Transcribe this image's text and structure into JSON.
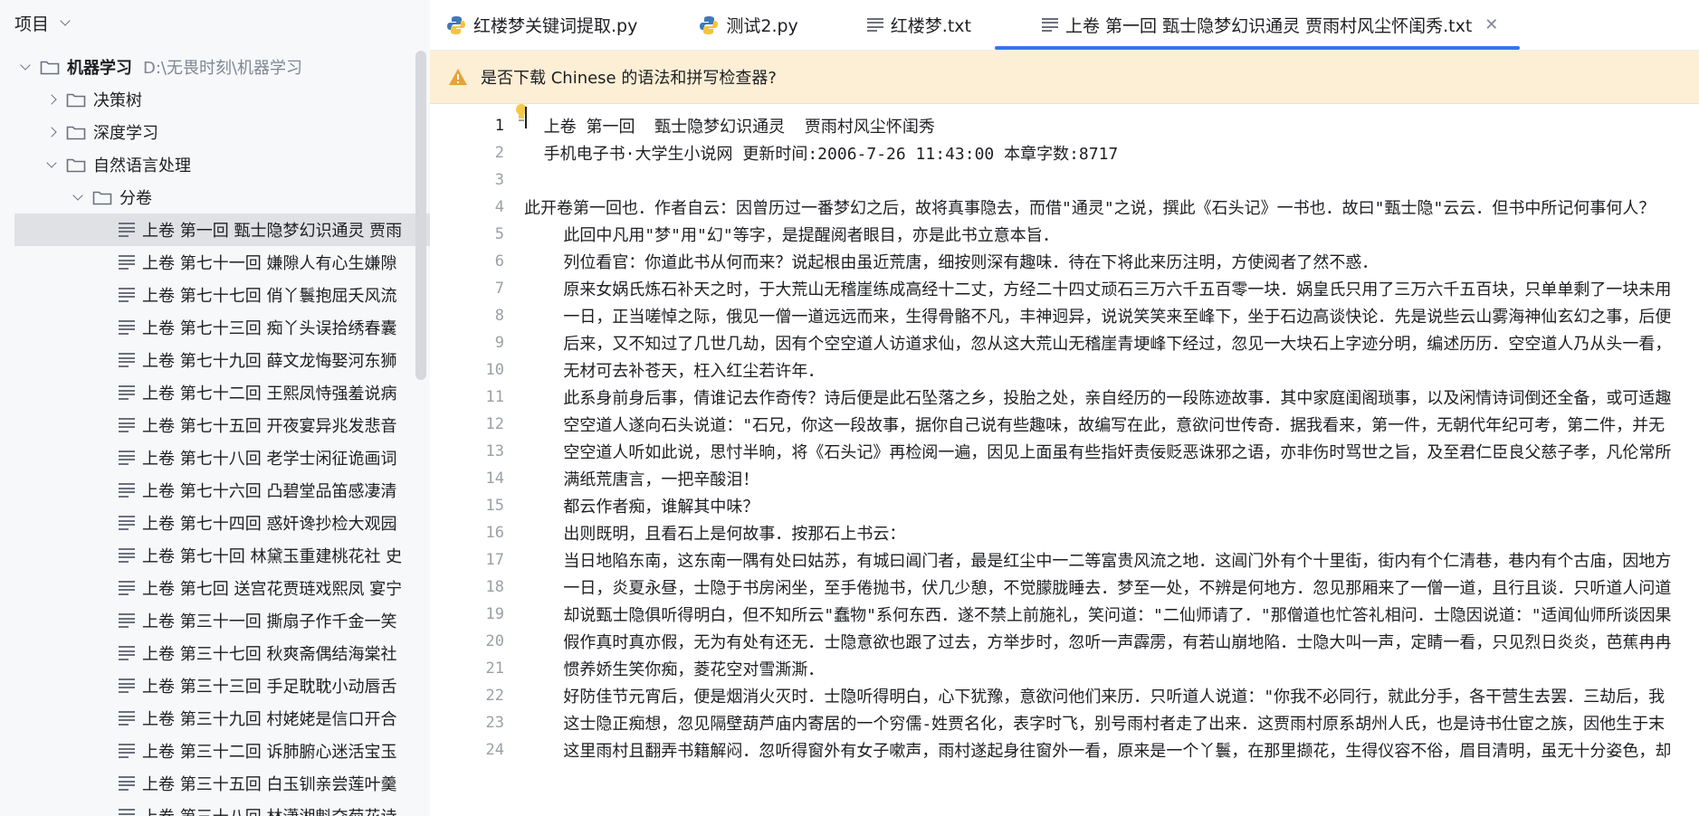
{
  "sidebar": {
    "header_title": "项目",
    "tree": [
      {
        "label": "机器学习",
        "path": "D:\\无畏时刻\\机器学习",
        "indent": 0,
        "type": "folder",
        "expanded": true
      },
      {
        "label": "决策树",
        "indent": 1,
        "type": "folder",
        "expanded": false
      },
      {
        "label": "深度学习",
        "indent": 1,
        "type": "folder",
        "expanded": false
      },
      {
        "label": "自然语言处理",
        "indent": 1,
        "type": "folder",
        "expanded": true
      },
      {
        "label": "分卷",
        "indent": 2,
        "type": "folder",
        "expanded": true
      },
      {
        "label": "上卷 第一回  甄士隐梦幻识通灵  贾雨",
        "indent": 3,
        "type": "file",
        "selected": true
      },
      {
        "label": "上卷 第七十一回  嫌隙人有心生嫌隙",
        "indent": 3,
        "type": "file"
      },
      {
        "label": "上卷 第七十七回  俏丫鬟抱屈夭风流",
        "indent": 3,
        "type": "file"
      },
      {
        "label": "上卷 第七十三回  痴丫头误拾绣春囊",
        "indent": 3,
        "type": "file"
      },
      {
        "label": "上卷 第七十九回  薛文龙悔娶河东狮",
        "indent": 3,
        "type": "file"
      },
      {
        "label": "上卷 第七十二回  王熙凤恃强羞说病",
        "indent": 3,
        "type": "file"
      },
      {
        "label": "上卷 第七十五回  开夜宴异兆发悲音",
        "indent": 3,
        "type": "file"
      },
      {
        "label": "上卷 第七十八回  老学士闲征诡画词",
        "indent": 3,
        "type": "file"
      },
      {
        "label": "上卷 第七十六回  凸碧堂品笛感凄清",
        "indent": 3,
        "type": "file"
      },
      {
        "label": "上卷 第七十四回  惑奸谗抄检大观园",
        "indent": 3,
        "type": "file"
      },
      {
        "label": "上卷 第七十回  林黛玉重建桃花社  史",
        "indent": 3,
        "type": "file"
      },
      {
        "label": "上卷 第七回  送宫花贾琏戏熙凤  宴宁",
        "indent": 3,
        "type": "file"
      },
      {
        "label": "上卷 第三十一回  撕扇子作千金一笑",
        "indent": 3,
        "type": "file"
      },
      {
        "label": "上卷 第三十七回  秋爽斋偶结海棠社",
        "indent": 3,
        "type": "file"
      },
      {
        "label": "上卷 第三十三回  手足耽耽小动唇舌",
        "indent": 3,
        "type": "file"
      },
      {
        "label": "上卷 第三十九回  村姥姥是信口开合",
        "indent": 3,
        "type": "file"
      },
      {
        "label": "上卷 第三十二回  诉肺腑心迷活宝玉",
        "indent": 3,
        "type": "file"
      },
      {
        "label": "上卷 第三十五回  白玉钏亲尝莲叶羹",
        "indent": 3,
        "type": "file"
      },
      {
        "label": "上卷 第三十八回  林潇湘魁夺菊花诗",
        "indent": 3,
        "type": "file"
      }
    ]
  },
  "tabs": [
    {
      "label": "红楼梦关键词提取.py",
      "icon": "python-icon",
      "active": false
    },
    {
      "label": "测试2.py",
      "icon": "python-icon",
      "active": false
    },
    {
      "label": "红楼梦.txt",
      "icon": "text-file-icon",
      "active": false
    },
    {
      "label": "上卷 第一回  甄士隐梦幻识通灵  贾雨村风尘怀闺秀.txt",
      "icon": "text-file-icon",
      "active": true,
      "closable": true
    }
  ],
  "banner": {
    "text": "是否下载 Chinese 的语法和拼写检查器?",
    "icon": "warning-icon"
  },
  "editor": {
    "lines": [
      {
        "n": "1",
        "text": "  上卷 第一回  甄士隐梦幻识通灵  贾雨村风尘怀闺秀"
      },
      {
        "n": "2",
        "text": "  手机电子书·大学生小说网 更新时间:2006-7-26 11:43:00 本章字数:8717"
      },
      {
        "n": "3",
        "text": ""
      },
      {
        "n": "4",
        "text": "此开卷第一回也．作者自云：因曾历过一番梦幻之后，故将真事隐去，而借\"通灵\"之说，撰此《石头记》一书也．故曰\"甄士隐\"云云．但书中所记何事何人？"
      },
      {
        "n": "5",
        "text": "    此回中凡用\"梦\"用\"幻\"等字，是提醒阅者眼目，亦是此书立意本旨．"
      },
      {
        "n": "6",
        "text": "    列位看官：你道此书从何而来？说起根由虽近荒唐，细按则深有趣味．待在下将此来历注明，方使阅者了然不惑．"
      },
      {
        "n": "7",
        "text": "    原来女娲氏炼石补天之时，于大荒山无稽崖练成高经十二丈，方经二十四丈顽石三万六千五百零一块．娲皇氏只用了三万六千五百块，只单单剩了一块未用"
      },
      {
        "n": "8",
        "text": "    一日，正当嗟悼之际，俄见一僧一道远远而来，生得骨骼不凡，丰神迥异，说说笑笑来至峰下，坐于石边高谈快论．先是说些云山雾海神仙玄幻之事，后便"
      },
      {
        "n": "9",
        "text": "    后来，又不知过了几世几劫，因有个空空道人访道求仙，忽从这大荒山无稽崖青埂峰下经过，忽见一大块石上字迹分明，编述历历．空空道人乃从头一看，"
      },
      {
        "n": "10",
        "text": "    无材可去补苍天，枉入红尘若许年．"
      },
      {
        "n": "11",
        "text": "    此系身前身后事，倩谁记去作奇传？诗后便是此石坠落之乡，投胎之处，亲自经历的一段陈迹故事．其中家庭闺阁琐事，以及闲情诗词倒还全备，或可适趣"
      },
      {
        "n": "12",
        "text": "    空空道人遂向石头说道：\"石兄，你这一段故事，据你自己说有些趣味，故编写在此，意欲问世传奇．据我看来，第一件，无朝代年纪可考，第二件，并无"
      },
      {
        "n": "13",
        "text": "    空空道人听如此说，思忖半晌，将《石头记》再检阅一遍，因见上面虽有些指奸责佞贬恶诛邪之语，亦非伤时骂世之旨，及至君仁臣良父慈子孝，凡伦常所"
      },
      {
        "n": "14",
        "text": "    满纸荒唐言，一把辛酸泪！"
      },
      {
        "n": "15",
        "text": "    都云作者痴，谁解其中味？"
      },
      {
        "n": "16",
        "text": "    出则既明，且看石上是何故事．按那石上书云："
      },
      {
        "n": "17",
        "text": "    当日地陷东南，这东南一隅有处曰姑苏，有城曰阊门者，最是红尘中一二等富贵风流之地．这阊门外有个十里街，街内有个仁清巷，巷内有个古庙，因地方"
      },
      {
        "n": "18",
        "text": "    一日，炎夏永昼，士隐于书房闲坐，至手倦抛书，伏几少憩，不觉朦胧睡去．梦至一处，不辨是何地方．忽见那厢来了一僧一道，且行且谈．只听道人问道"
      },
      {
        "n": "19",
        "text": "    却说甄士隐俱听得明白，但不知所云\"蠢物\"系何东西．遂不禁上前施礼，笑问道：\"二仙师请了．\"那僧道也忙答礼相问．士隐因说道：\"适闻仙师所谈因果"
      },
      {
        "n": "20",
        "text": "    假作真时真亦假，无为有处有还无．士隐意欲也跟了过去，方举步时，忽听一声霹雳，有若山崩地陷．士隐大叫一声，定睛一看，只见烈日炎炎，芭蕉冉冉"
      },
      {
        "n": "21",
        "text": "    惯养娇生笑你痴，菱花空对雪澌澌．"
      },
      {
        "n": "22",
        "text": "    好防佳节元宵后，便是烟消火灭时．士隐听得明白，心下犹豫，意欲问他们来历．只听道人说道：\"你我不必同行，就此分手，各干营生去罢．三劫后，我"
      },
      {
        "n": "23",
        "text": "    这士隐正痴想，忽见隔壁葫芦庙内寄居的一个穷儒-姓贾名化，表字时飞，别号雨村者走了出来．这贾雨村原系胡州人氏，也是诗书仕宦之族，因他生于末"
      },
      {
        "n": "24",
        "text": "    这里雨村且翻弄书籍解闷．忽听得窗外有女子嗽声，雨村遂起身往窗外一看，原来是一个丫鬟，在那里撷花，生得仪容不俗，眉目清明，虽无十分姿色，却"
      }
    ]
  },
  "colors": {
    "accent": "#3574f0",
    "banner_bg": "#fcefd6",
    "selected_row": "#dfe1e5",
    "warning": "#e6a23c"
  }
}
